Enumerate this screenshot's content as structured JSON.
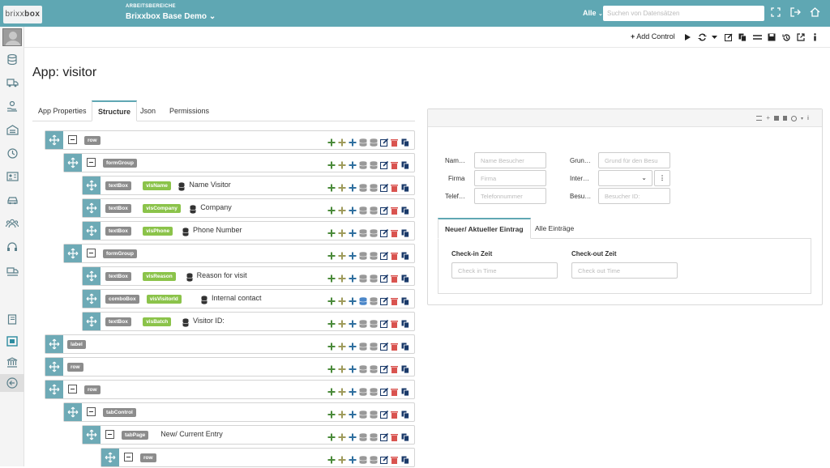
{
  "brand": {
    "logo_light": "brixx",
    "logo_bold": "box"
  },
  "header": {
    "workspace_label": "ARBEITSBEREICHE",
    "workspace_name": "Brixxbox Base Demo",
    "scope": "Alle",
    "search_placeholder": "Suchen von Datensätzen"
  },
  "toolbar": {
    "add_control": "Add Control"
  },
  "page": {
    "title": "App: visitor"
  },
  "tabs": [
    {
      "label": "App Properties"
    },
    {
      "label": "Structure"
    },
    {
      "label": "Json"
    },
    {
      "label": "Permissions"
    }
  ],
  "structure": [
    {
      "type": "row",
      "level": 0,
      "collapsible": true,
      "name": "",
      "text": ""
    },
    {
      "type": "formGroup",
      "level": 1,
      "collapsible": true,
      "name": "",
      "text": ""
    },
    {
      "type": "textBox",
      "level": 2,
      "collapsible": false,
      "name": "visName",
      "text": "Name Visitor"
    },
    {
      "type": "textBox",
      "level": 2,
      "collapsible": false,
      "name": "visCompany",
      "text": "Company"
    },
    {
      "type": "textBox",
      "level": 2,
      "collapsible": false,
      "name": "visPhone",
      "text": "Phone Number"
    },
    {
      "type": "formGroup",
      "level": 1,
      "collapsible": true,
      "name": "",
      "text": ""
    },
    {
      "type": "textBox",
      "level": 2,
      "collapsible": false,
      "name": "visReason",
      "text": "Reason for visit"
    },
    {
      "type": "comboBox",
      "level": 2,
      "collapsible": false,
      "name": "visVisitorId",
      "text": "Internal contact"
    },
    {
      "type": "textBox",
      "level": 2,
      "collapsible": false,
      "name": "visBatch",
      "text": "Visitor ID:"
    },
    {
      "type": "label",
      "level": 0,
      "collapsible": false,
      "name": "",
      "text": ""
    },
    {
      "type": "row",
      "level": 0,
      "collapsible": false,
      "name": "",
      "text": ""
    },
    {
      "type": "row",
      "level": 0,
      "collapsible": true,
      "name": "",
      "text": ""
    },
    {
      "type": "tabControl",
      "level": 1,
      "collapsible": true,
      "name": "",
      "text": ""
    },
    {
      "type": "tabPage",
      "level": 2,
      "collapsible": true,
      "name": "",
      "text": "New/ Current Entry"
    },
    {
      "type": "row",
      "level": 3,
      "collapsible": true,
      "name": "",
      "text": ""
    }
  ],
  "preview": {
    "fields": [
      {
        "label": "Nam…",
        "placeholder": "Name Besucher"
      },
      {
        "label": "Firma",
        "placeholder": "Firma"
      },
      {
        "label": "Telef…",
        "placeholder": "Telefonnummer"
      },
      {
        "label": "Grun…",
        "placeholder": "Grund für den Besu"
      },
      {
        "label": "Inter…",
        "placeholder": ""
      },
      {
        "label": "Besu…",
        "placeholder": "Besucher ID:"
      }
    ],
    "tabs": [
      {
        "label": "Neuer/ Aktueller Eintrag"
      },
      {
        "label": "Alle Einträge"
      }
    ],
    "checkin": {
      "label": "Check-in Zeit",
      "placeholder": "Check in Time"
    },
    "checkout": {
      "label": "Check-out Zeit",
      "placeholder": "Check out Time"
    }
  },
  "colors": {
    "accent": "#5fa7b3",
    "handle": "#6eaab6",
    "green": "#8bc34a",
    "badge": "#8c8c8c",
    "delete": "#d9534f"
  }
}
